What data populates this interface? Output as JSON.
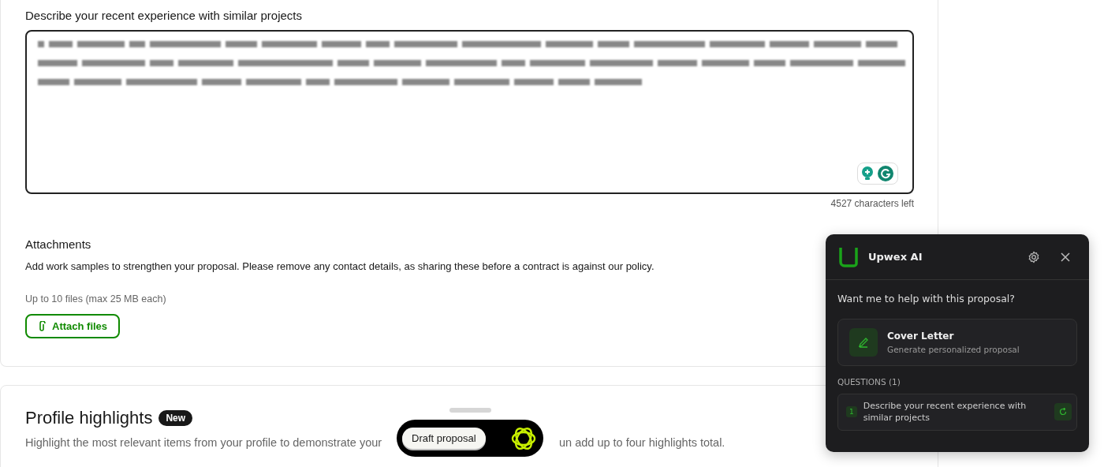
{
  "experience": {
    "label": "Describe your recent experience with similar projects",
    "characters_left": "4527 characters left"
  },
  "attachments": {
    "title": "Attachments",
    "description": "Add work samples to strengthen your proposal. Please remove any contact details, as sharing these before a contract is against our policy.",
    "limit": "Up to 10 files (max 25 MB each)",
    "button": "Attach files"
  },
  "profile_highlights": {
    "title": "Profile highlights",
    "badge": "New",
    "description_visible_start": "Highlight the most relevant items from your profile to demonstrate your",
    "description_visible_end": "un add up to four highlights total."
  },
  "draft_bar": {
    "button": "Draft proposal"
  },
  "assistant_panel": {
    "title": "Upwex AI",
    "prompt": "Want me to help with this proposal?",
    "action": {
      "title": "Cover Letter",
      "subtitle": "Generate personalized proposal"
    },
    "questions_heading": "QUESTIONS (1)",
    "questions": [
      {
        "number": "1",
        "text": "Describe your recent experience with similar projects"
      }
    ]
  }
}
